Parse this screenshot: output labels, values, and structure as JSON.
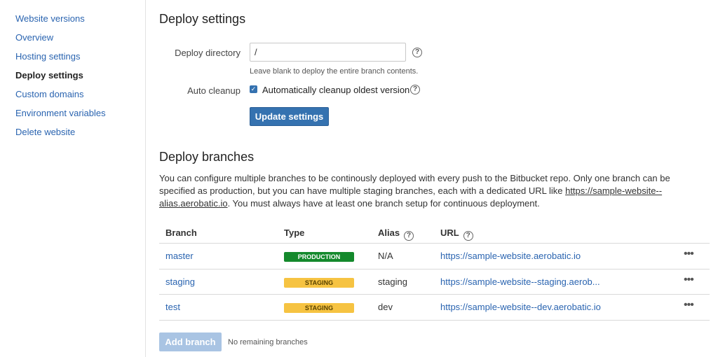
{
  "sidebar": {
    "items": [
      {
        "label": "Website versions"
      },
      {
        "label": "Overview"
      },
      {
        "label": "Hosting settings"
      },
      {
        "label": "Deploy settings",
        "active": true
      },
      {
        "label": "Custom domains"
      },
      {
        "label": "Environment variables"
      },
      {
        "label": "Delete website"
      }
    ]
  },
  "deploy_settings": {
    "title": "Deploy settings",
    "directory_label": "Deploy directory",
    "directory_value": "/",
    "directory_hint": "Leave blank to deploy the entire branch contents.",
    "cleanup_label": "Auto cleanup",
    "cleanup_checkbox_label": "Automatically cleanup oldest version",
    "cleanup_checked": true,
    "update_button": "Update settings"
  },
  "deploy_branches": {
    "title": "Deploy branches",
    "description_pre": "You can configure multiple branches to be continously deployed with every push to the Bitbucket repo. Only one branch can be specified as production, but you can have multiple staging branches, each with a dedicated URL like ",
    "description_link": "https://sample-website--alias.aerobatic.io",
    "description_post": ". You must always have at least one branch setup for continuous deployment.",
    "columns": {
      "branch": "Branch",
      "type": "Type",
      "alias": "Alias",
      "url": "URL"
    },
    "rows": [
      {
        "branch": "master",
        "type": "PRODUCTION",
        "alias": "N/A",
        "url": "https://sample-website.aerobatic.io",
        "more": "•••"
      },
      {
        "branch": "staging",
        "type": "STAGING",
        "alias": "staging",
        "url": "https://sample-website--staging.aerob...",
        "more": "•••"
      },
      {
        "branch": "test",
        "type": "STAGING",
        "alias": "dev",
        "url": "https://sample-website--dev.aerobatic.io",
        "more": "•••"
      }
    ],
    "add_button": "Add branch",
    "add_note": "No remaining branches"
  },
  "icons": {
    "help": "?",
    "check": "✓"
  },
  "colors": {
    "link": "#2a64b0",
    "primary": "#3572b0",
    "production": "#14892c",
    "staging": "#f6c342"
  }
}
